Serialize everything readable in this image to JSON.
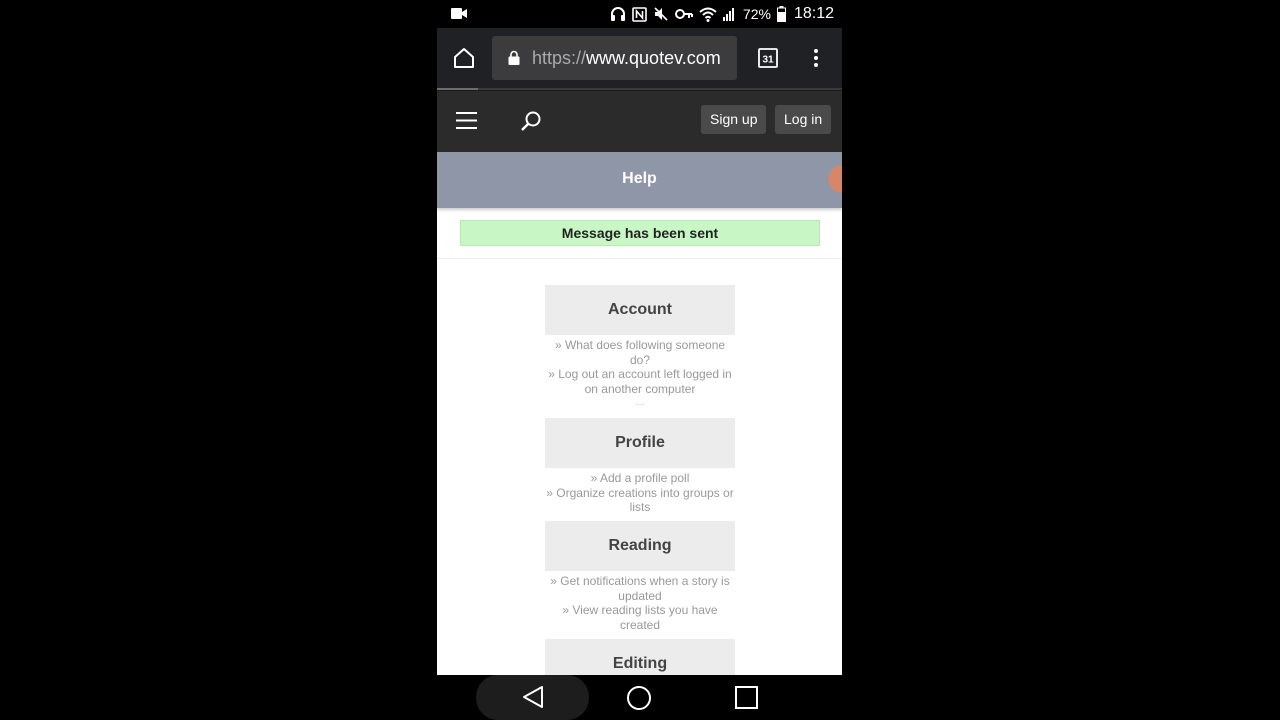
{
  "status_bar": {
    "battery": "72%",
    "time": "18:12"
  },
  "browser": {
    "url_scheme": "https://",
    "url_host": "www.quotev.com",
    "tab_count": "31",
    "load_progress": 0.1
  },
  "site_header": {
    "signup_label": "Sign up",
    "login_label": "Log in"
  },
  "page": {
    "title": "Help",
    "notice": "Message has been sent"
  },
  "sections": [
    {
      "title": "Account",
      "links": [
        "» What does following someone do?",
        "» Log out an account left logged in on another computer"
      ],
      "more": "..."
    },
    {
      "title": "Profile",
      "links": [
        "» Add a profile poll",
        "» Organize creations into groups or lists"
      ]
    },
    {
      "title": "Reading",
      "links": [
        "» Get notifications when a story is updated",
        "» View reading lists you have created"
      ]
    },
    {
      "title": "Editing",
      "links": []
    }
  ]
}
